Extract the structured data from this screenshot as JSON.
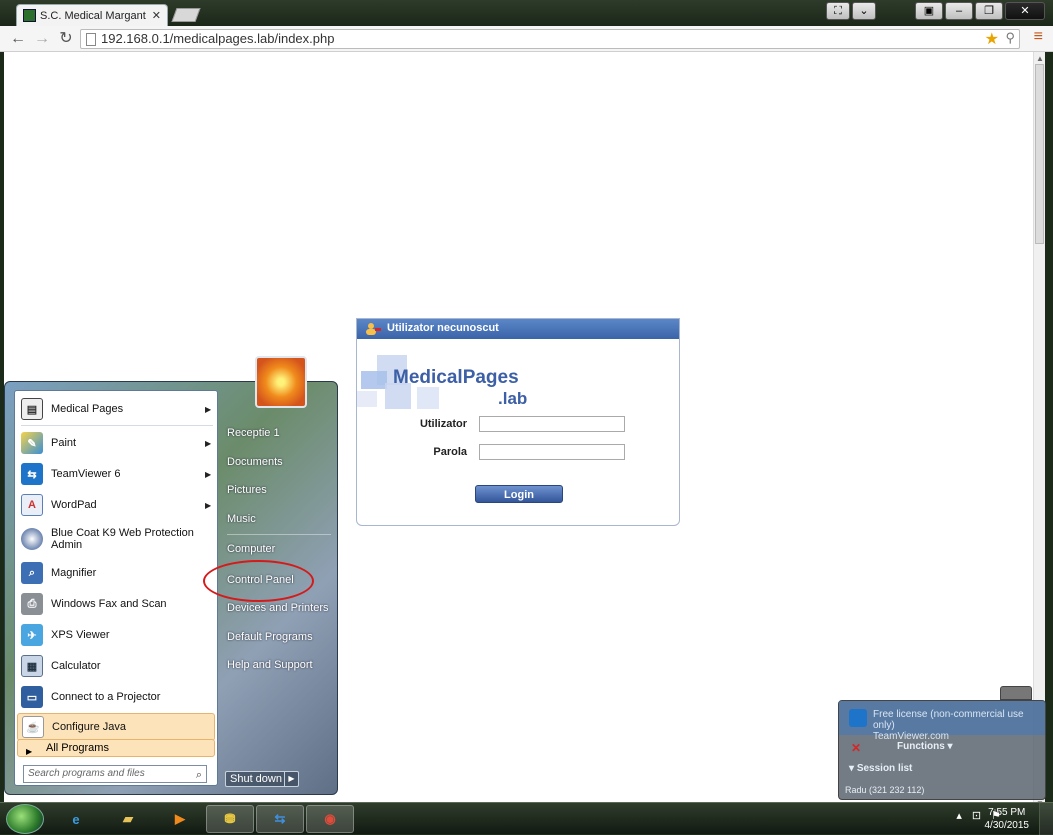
{
  "browser": {
    "tab_title": "S.C. Medical Margant S.R.L",
    "tab_close": "✕",
    "url": "192.168.0.1/medicalpages.lab/index.php"
  },
  "login": {
    "header": "Utilizator necunoscut",
    "logo_main": "MedicalPages",
    "logo_sub": ".lab",
    "user_label": "Utilizator",
    "user_value": "",
    "pass_label": "Parola",
    "pass_value": "",
    "button": "Login"
  },
  "start_menu": {
    "programs": [
      {
        "label": "Medical Pages",
        "icon": "medical-pages-icon",
        "arrow": true
      },
      {
        "label": "Paint",
        "icon": "paint-icon",
        "arrow": true
      },
      {
        "label": "TeamViewer 6",
        "icon": "teamviewer-icon",
        "arrow": true
      },
      {
        "label": "WordPad",
        "icon": "wordpad-icon",
        "arrow": true
      },
      {
        "label": "Blue Coat K9 Web Protection Admin",
        "icon": "bluecoat-icon",
        "arrow": false
      },
      {
        "label": "Magnifier",
        "icon": "magnifier-icon",
        "arrow": false
      },
      {
        "label": "Windows Fax and Scan",
        "icon": "fax-icon",
        "arrow": false
      },
      {
        "label": "XPS Viewer",
        "icon": "xps-icon",
        "arrow": false
      },
      {
        "label": "Calculator",
        "icon": "calculator-icon",
        "arrow": false
      },
      {
        "label": "Connect to a Projector",
        "icon": "projector-icon",
        "arrow": false
      },
      {
        "label": "Configure Java",
        "icon": "java-icon",
        "arrow": false
      }
    ],
    "all_programs": "All Programs",
    "search_placeholder": "Search programs and files",
    "right_items": [
      "Receptie 1",
      "Documents",
      "Pictures",
      "Music",
      "Computer",
      "Control Panel",
      "Devices and Printers",
      "Default Programs",
      "Help and Support"
    ],
    "shutdown": "Shut down"
  },
  "teamviewer": {
    "title_line1": "Free license (non-commercial use only)",
    "title_line2": "TeamViewer.com",
    "functions": "Functions",
    "session_list": "Session list",
    "user": "Radu (321 232 112)"
  },
  "taskbar": {
    "time": "7:55 PM",
    "date": "4/30/2015"
  },
  "colors": {
    "login_header": "#3a64a8",
    "logo_text": "#3c5fa5",
    "highlight": "#fde3b9",
    "annotation_oval": "#d41b1b"
  }
}
